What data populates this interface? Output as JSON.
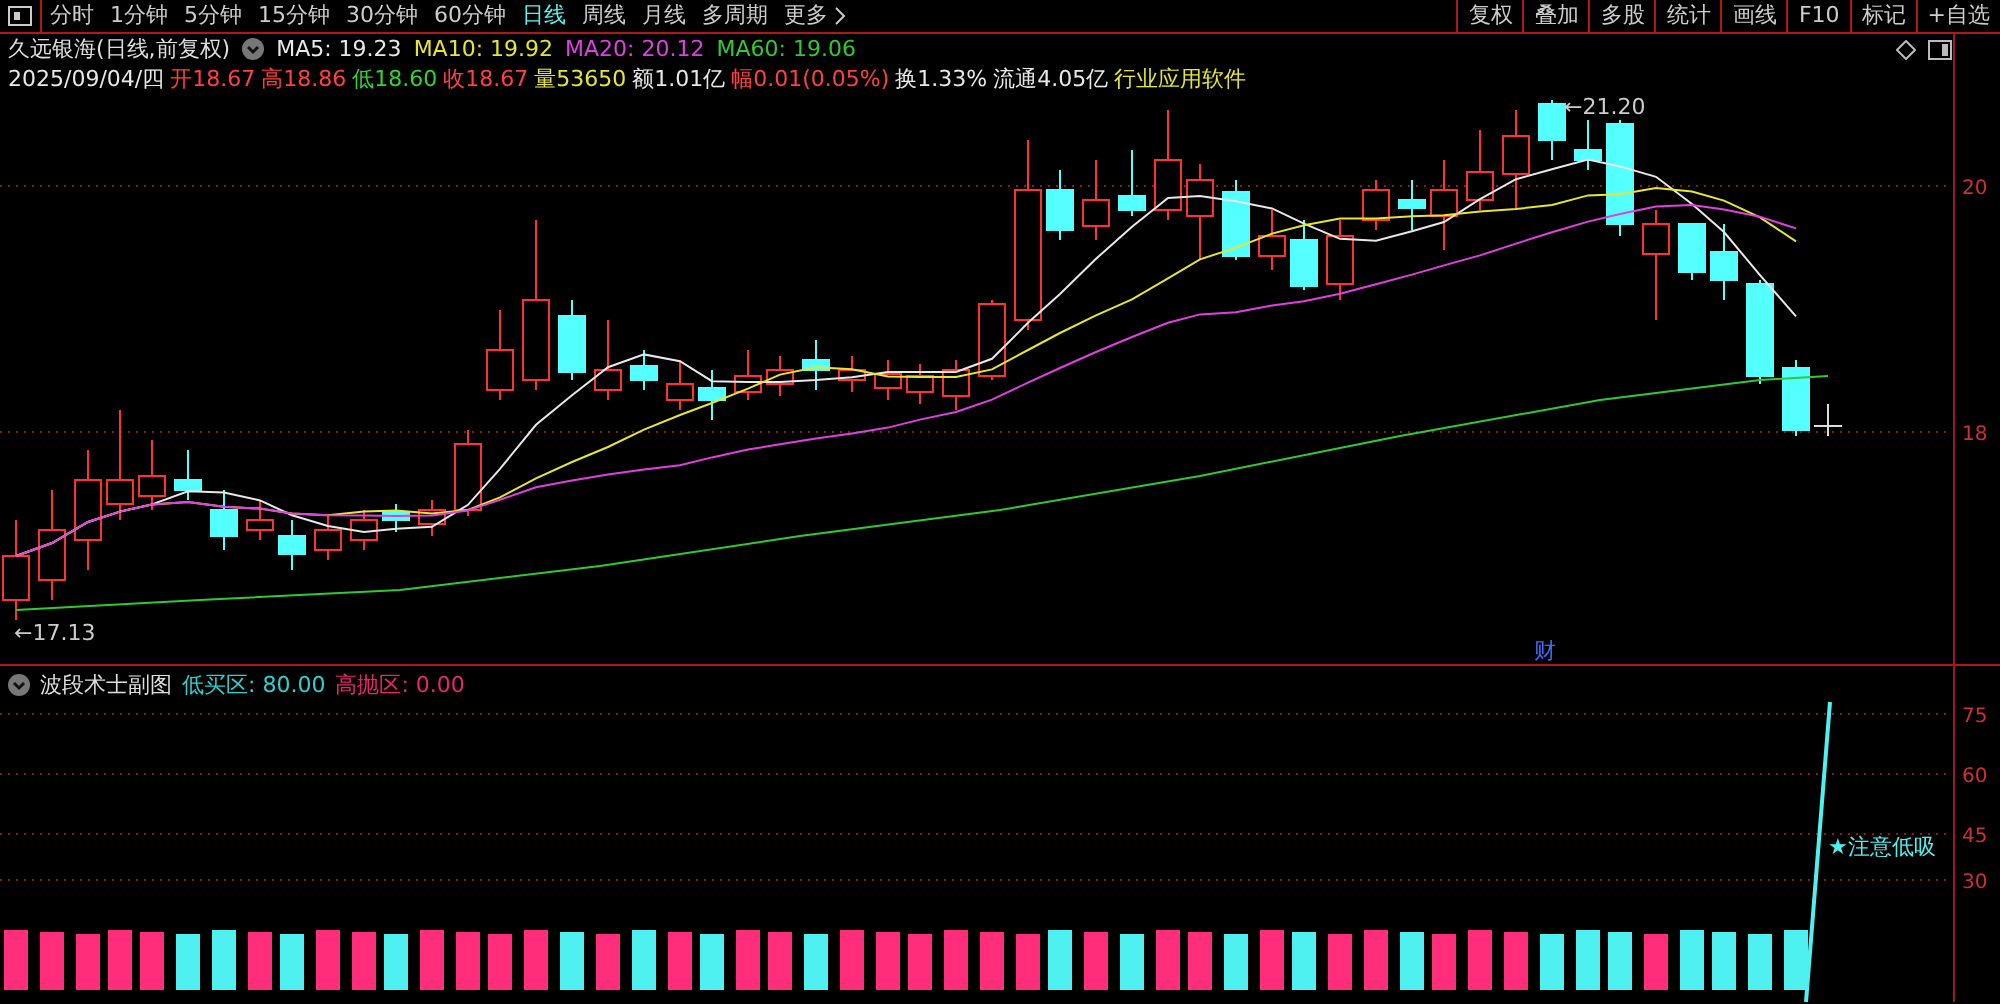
{
  "toolbar": {
    "tabs": [
      {
        "label": "分时",
        "selected": false
      },
      {
        "label": "1分钟",
        "selected": false
      },
      {
        "label": "5分钟",
        "selected": false
      },
      {
        "label": "15分钟",
        "selected": false
      },
      {
        "label": "30分钟",
        "selected": false
      },
      {
        "label": "60分钟",
        "selected": false
      },
      {
        "label": "日线",
        "selected": true
      },
      {
        "label": "周线",
        "selected": false
      },
      {
        "label": "月线",
        "selected": false
      },
      {
        "label": "多周期",
        "selected": false
      },
      {
        "label": "更多",
        "selected": false
      }
    ],
    "buttons": [
      "复权",
      "叠加",
      "多股",
      "统计",
      "画线",
      "F10",
      "标记",
      "+自选"
    ]
  },
  "stock": {
    "title": "久远银海(日线,前复权)",
    "ma": [
      {
        "label": "MA5: 19.23",
        "color": "#e8e8e8"
      },
      {
        "label": "MA10: 19.92",
        "color": "#e6e632"
      },
      {
        "label": "MA20: 20.12",
        "color": "#e040e0"
      },
      {
        "label": "MA60: 19.06",
        "color": "#32c832"
      }
    ]
  },
  "quote": [
    {
      "text": "2025/09/04/四",
      "color": "#e8e8e8"
    },
    {
      "text": "开18.67",
      "color": "#ff4040"
    },
    {
      "text": "高18.86",
      "color": "#ff4040"
    },
    {
      "text": "低18.60",
      "color": "#32d232"
    },
    {
      "text": "收18.67",
      "color": "#ff4040"
    },
    {
      "text": "量53650",
      "color": "#e6e632"
    },
    {
      "text": "额1.01亿",
      "color": "#e8e8e8"
    },
    {
      "text": "幅0.01(0.05%)",
      "color": "#ff4040"
    },
    {
      "text": "换1.33%",
      "color": "#e8e8e8"
    },
    {
      "text": "流通4.05亿",
      "color": "#e8e8e8"
    },
    {
      "text": "行业应用软件",
      "color": "#e6e632"
    }
  ],
  "main_chart": {
    "high_label": "←21.20",
    "low_label": "←17.13",
    "event_mark": "财",
    "axis": [
      "20",
      "18"
    ]
  },
  "sub_chart": {
    "title": "波段术士副图",
    "values": [
      {
        "text": "低买区: 80.00",
        "color": "#2ed0d0"
      },
      {
        "text": "高抛区: 0.00",
        "color": "#e8266e"
      }
    ],
    "axis": [
      "75",
      "60",
      "45",
      "30"
    ],
    "signal": "★注意低吸"
  }
}
